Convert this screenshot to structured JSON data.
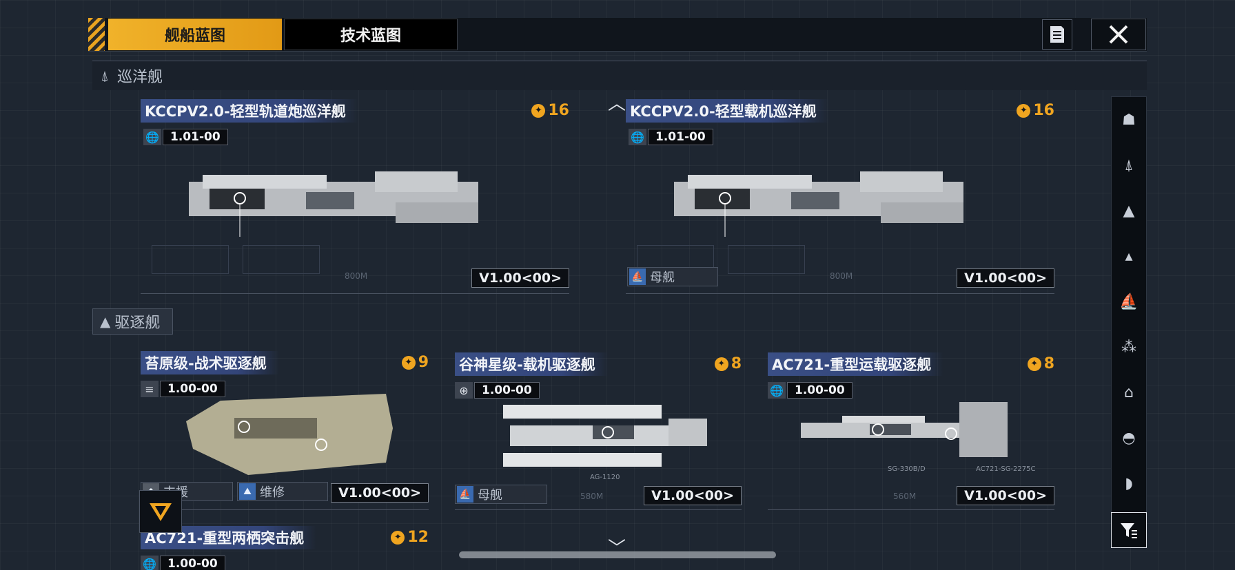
{
  "tabs": [
    {
      "label": "舰船蓝图",
      "active": true
    },
    {
      "label": "技术蓝图",
      "active": false
    }
  ],
  "top_buttons": {
    "notes_icon": "document-icon",
    "close_icon": "close-icon"
  },
  "sections": {
    "cruiser": {
      "title": "巡洋舰",
      "icon": "cruiser-icon"
    },
    "destroyer": {
      "title": "驱逐舰",
      "icon": "destroyer-icon"
    }
  },
  "ships": [
    {
      "name": "KCCPV2.0-轻型轨道炮巡洋舰",
      "cost": "16",
      "version": "1.01",
      "version_suffix": "00",
      "blueprint_version": "V1.00<00>",
      "tags": []
    },
    {
      "name": "KCCPV2.0-轻型载机巡洋舰",
      "cost": "16",
      "version": "1.01",
      "version_suffix": "00",
      "blueprint_version": "V1.00<00>",
      "tags": [
        "母舰"
      ]
    },
    {
      "name": "苔原级-战术驱逐舰",
      "cost": "9",
      "version": "1.00",
      "version_suffix": "00",
      "blueprint_version": "V1.00<00>",
      "tags": [
        "支援",
        "维修"
      ]
    },
    {
      "name": "谷神星级-载机驱逐舰",
      "cost": "8",
      "version": "1.00",
      "version_suffix": "00",
      "blueprint_version": "V1.00<00>",
      "tags": [
        "母舰"
      ]
    },
    {
      "name": "AC721-重型运载驱逐舰",
      "cost": "8",
      "version": "1.00",
      "version_suffix": "00",
      "blueprint_version": "V1.00<00>",
      "tags": []
    },
    {
      "name": "AC721-重型两栖突击舰",
      "cost": "12",
      "version": "1.00",
      "version_suffix": "00",
      "blueprint_version": "",
      "tags": []
    }
  ],
  "blueprint_labels": {
    "length_800": "800M",
    "length_580": "580M",
    "length_560": "560M",
    "ag1120": "AG-1120",
    "sg330": "SG-330B/D",
    "ac721sg": "AC721-SG-2275C"
  },
  "sidebar_icons": [
    "frigate-icon",
    "cruiser-icon",
    "destroyer-icon",
    "battlecruiser-icon",
    "carrier-icon",
    "auxiliary-icon",
    "station-icon",
    "dome-icon",
    "base-icon",
    "filter-icon"
  ],
  "colors": {
    "accent": "#f0a520",
    "name_bg": "#3a4f86",
    "tag_icon": "#3a6ab0"
  }
}
